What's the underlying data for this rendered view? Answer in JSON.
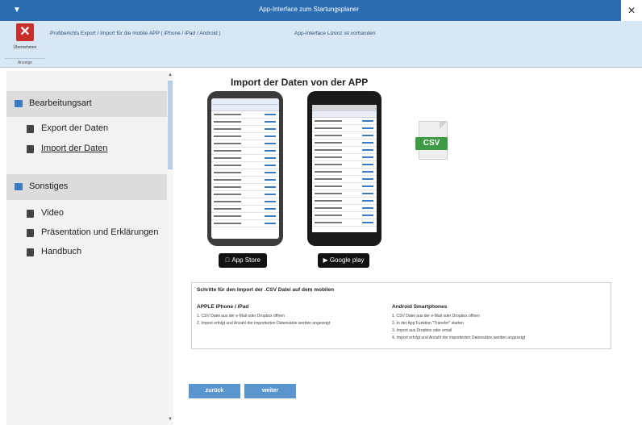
{
  "titlebar": {
    "menu_glyph": "▼",
    "title": "App-Interface zum Startungsplaner",
    "close_glyph": "✕"
  },
  "ribbon": {
    "close_button_glyph": "✕",
    "close_button_label": "Übernehmen",
    "group_label": "Anzeige",
    "info_text": "Profiberichts Export / Import für die mobile APP ( iPhone / iPad / Android )",
    "license_text": "App-Interface Lizenz ist vorhanden"
  },
  "sidebar": {
    "sections": [
      {
        "label": "Bearbeitungsart",
        "items": [
          {
            "label": "Export der Daten"
          },
          {
            "label": "Import  der Daten"
          }
        ]
      },
      {
        "label": "Sonstiges",
        "items": [
          {
            "label": "Video"
          },
          {
            "label": "Präsentation und Erklärungen"
          },
          {
            "label": "Handbuch"
          }
        ]
      }
    ],
    "scroll_up_glyph": "▲",
    "scroll_down_glyph": "▼"
  },
  "main": {
    "title": "Import der Daten von der APP",
    "app_store_label": " App Store",
    "google_play_label": "Google play",
    "csv_label": "CSV",
    "steps_heading": "Schritte für den Import der .CSV Datei auf dem mobilen",
    "apple": {
      "title": "APPLE iPhone / iPad",
      "steps": [
        "1. CSV Datei aus der e-Mail oder Dropbox öffnen",
        "2. Import erfolgt und Anzahl der importierten Datensätze werden angezeigt"
      ]
    },
    "android": {
      "title": "Android Smartphones",
      "steps": [
        "1. CSV Datei aus der e-Mail oder Dropbox öffnen",
        "2. In der App Funktion \"Transfer\" starten",
        "3. Import aus Dropbox oder email",
        "4. Import erfolgt und Anzahl der importierten Datensätze werden angezeigt"
      ]
    },
    "back_label": "zurück",
    "next_label": "weiter"
  }
}
